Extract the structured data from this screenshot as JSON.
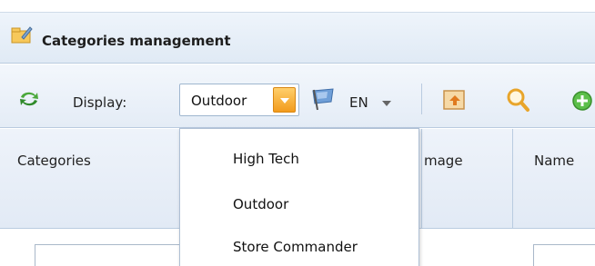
{
  "panel": {
    "title": "Categories management"
  },
  "toolbar": {
    "display_label": "Display:",
    "display_select": {
      "value": "Outdoor",
      "options": [
        "High Tech",
        "Outdoor",
        "Store Commander"
      ]
    },
    "language": "EN",
    "icons": [
      "refresh-icon",
      "flag-icon",
      "export-icon",
      "search-icon",
      "add-icon"
    ]
  },
  "grid": {
    "columns": [
      "Categories",
      "mage",
      "Name"
    ]
  },
  "colors": {
    "accent_orange": "#f29b1c",
    "header_blue": "#e2eaf5",
    "border_blue": "#b9cbe0"
  }
}
